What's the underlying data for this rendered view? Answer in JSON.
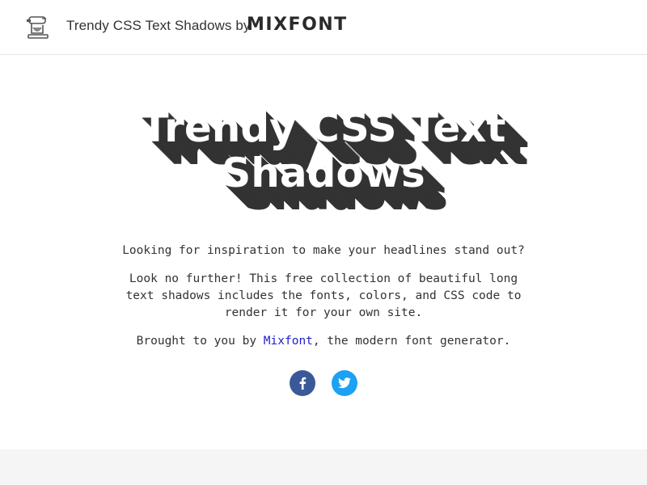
{
  "header": {
    "site_title": "Trendy CSS Text Shadows by",
    "brand": "MIXFONT",
    "logo_icon": "mixer-icon"
  },
  "hero": {
    "title": "Trendy CSS Text Shadows",
    "shadow_color": "#333333",
    "text_color": "#ffffff"
  },
  "content": {
    "line1": "Looking for inspiration to make your headlines stand out?",
    "line2": "Look no further! This free collection of beautiful long text shadows includes the fonts, colors, and CSS code to render it for your own site.",
    "line3_prefix": "Brought to you by ",
    "line3_link": "Mixfont",
    "line3_suffix": ", the modern font generator.",
    "link_color": "#1f1fc8"
  },
  "social": {
    "facebook_icon": "facebook-icon",
    "facebook_color": "#3b5998",
    "twitter_icon": "twitter-icon",
    "twitter_color": "#1da1f2"
  }
}
